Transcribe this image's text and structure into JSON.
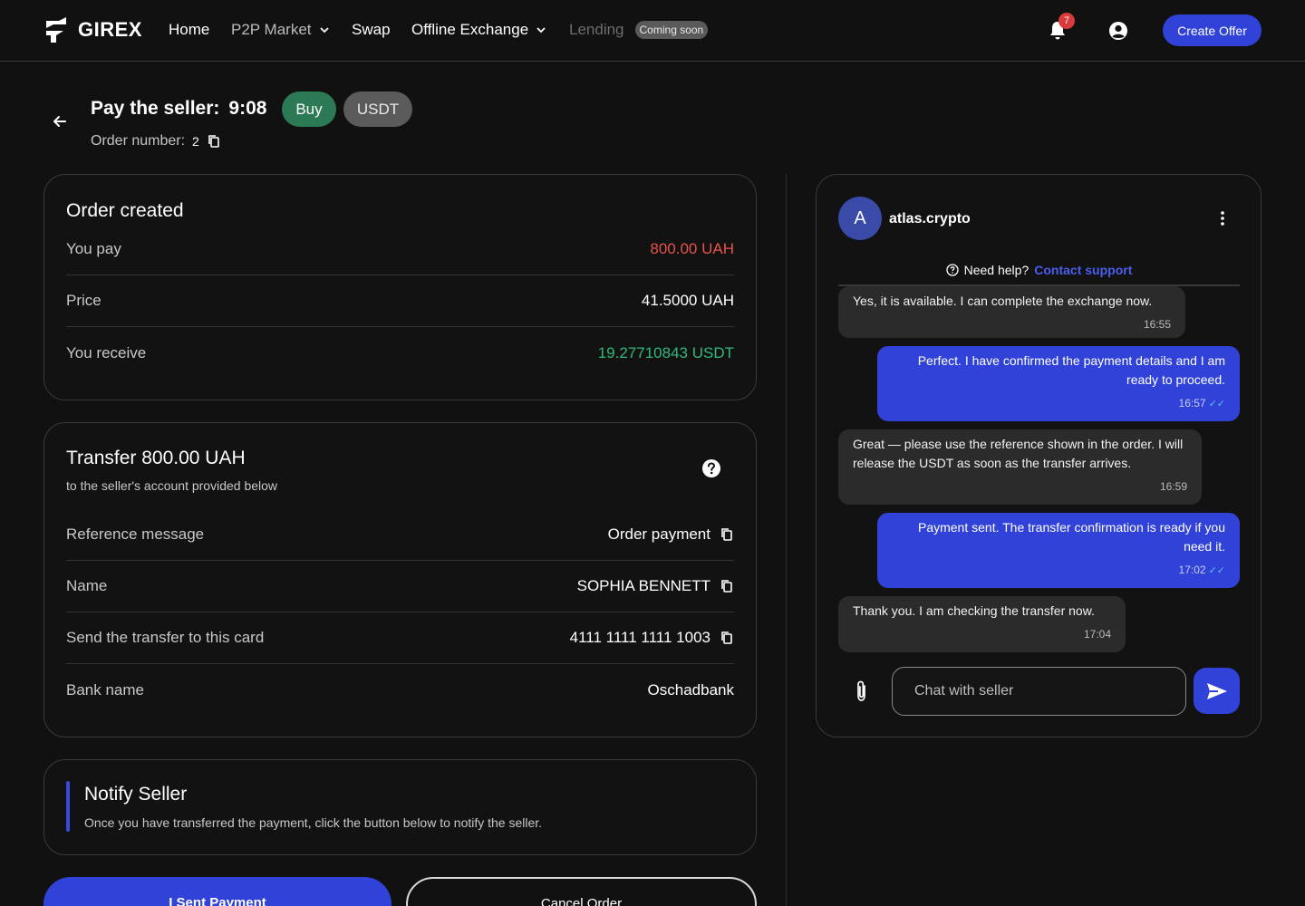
{
  "nav": {
    "brand": "GIREX",
    "items": [
      {
        "label": "Home"
      },
      {
        "label": "P2P Market"
      },
      {
        "label": "Swap"
      },
      {
        "label": "Offline Exchange"
      },
      {
        "label": "Lending"
      }
    ],
    "coming_soon": "Coming soon",
    "notification_count": "7",
    "create_offer": "Create Offer"
  },
  "header": {
    "pay_label": "Pay the seller:",
    "timer": "9:08",
    "side": "Buy",
    "asset": "USDT",
    "order_label": "Order number:",
    "order_value": "2"
  },
  "order_card": {
    "title": "Order created",
    "rows": [
      {
        "label": "You pay",
        "value": "800.00 UAH"
      },
      {
        "label": "Price",
        "value": "41.5000 UAH"
      },
      {
        "label": "You receive",
        "value": "19.27710843 USDT"
      }
    ]
  },
  "transfer_card": {
    "title": "Transfer 800.00 UAH",
    "subtitle": "to the seller's account provided below",
    "rows": [
      {
        "label": "Reference message",
        "value": "Order payment"
      },
      {
        "label": "Name",
        "value": "SOPHIA BENNETT"
      },
      {
        "label": "Send the transfer to this card",
        "value": "4111 1111 1111 1003"
      },
      {
        "label": "Bank name",
        "value": "Oschadbank"
      }
    ]
  },
  "notify_card": {
    "title": "Notify Seller",
    "text": "Once you have transferred the payment, click the button below to notify the seller."
  },
  "actions": {
    "sent": "I Sent Payment",
    "cancel": "Cancel Order"
  },
  "chat": {
    "avatar_letter": "A",
    "username": "atlas.crypto",
    "need_help": "Need help?",
    "contact_support": "Contact support",
    "messages": [
      {
        "text": "Yes, it is available. I can complete the exchange now.",
        "time": "16:55"
      },
      {
        "text": "Perfect. I have confirmed the payment details and I am ready to proceed.",
        "time": "16:57"
      },
      {
        "text": "Great — please use the reference shown in the order. I will release the USDT as soon as the transfer arrives.",
        "time": "16:59"
      },
      {
        "text": "Payment sent. The transfer confirmation is ready if you need it.",
        "time": "17:02"
      },
      {
        "text": "Thank you. I am checking the transfer now.",
        "time": "17:04"
      }
    ],
    "input_placeholder": "Chat with seller"
  },
  "colors": {
    "accent": "#3142d8",
    "buy_green": "#2c7a55",
    "pay_red": "#e8524a",
    "receive_green": "#2fb97a",
    "background": "#111111"
  }
}
